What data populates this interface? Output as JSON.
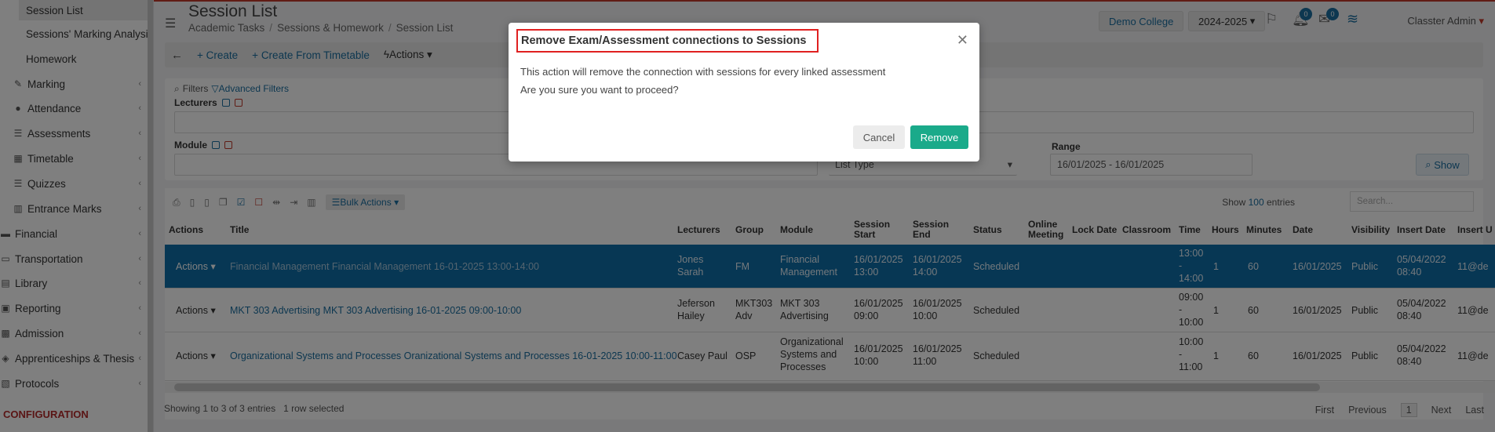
{
  "sidebar": {
    "items": [
      {
        "label": "Session List"
      },
      {
        "label": "Sessions' Marking Analysis"
      },
      {
        "label": "Homework"
      },
      {
        "label": "Marking",
        "icon": "edit-icon"
      },
      {
        "label": "Attendance",
        "icon": "user-icon"
      },
      {
        "label": "Assessments",
        "icon": "list-icon"
      },
      {
        "label": "Timetable",
        "icon": "calendar-icon"
      },
      {
        "label": "Quizzes",
        "icon": "list-icon"
      },
      {
        "label": "Entrance Marks",
        "icon": "building-icon"
      },
      {
        "label": "Financial",
        "icon": "money-icon"
      },
      {
        "label": "Transportation",
        "icon": "bus-icon"
      },
      {
        "label": "Library",
        "icon": "book-icon"
      },
      {
        "label": "Reporting",
        "icon": "printer-icon"
      },
      {
        "label": "Admission",
        "icon": "admission-icon"
      },
      {
        "label": "Apprenticeships & Thesis",
        "icon": "cube-icon"
      },
      {
        "label": "Protocols",
        "icon": "protocol-icon"
      }
    ],
    "config_label": "CONFIGURATION"
  },
  "header": {
    "title": "Session List",
    "breadcrumb": [
      "Academic Tasks",
      "Sessions & Homework",
      "Session List"
    ],
    "college": "Demo College",
    "year": "2024-2025",
    "notif_count": "0",
    "mail_count": "0",
    "user": "Classter Admin"
  },
  "toolbar": {
    "create": "Create",
    "create_tt": "Create From Timetable",
    "actions": "Actions"
  },
  "filters": {
    "filters_label": "Filters",
    "advanced": "Advanced Filters",
    "lecturers": "Lecturers",
    "module": "Module",
    "list_type": "List Type",
    "range_label": "Range",
    "range_value": "16/01/2025 - 16/01/2025",
    "show": "Show"
  },
  "table": {
    "bulk_actions": "Bulk Actions",
    "show_label": "Show",
    "show_count": "100",
    "entries": "entries",
    "search_placeholder": "Search...",
    "headers": {
      "actions": "Actions",
      "title": "Title",
      "lecturers": "Lecturers",
      "group": "Group",
      "module": "Module",
      "session_start": "Session Start",
      "session_end": "Session End",
      "status": "Status",
      "online": "Online Meeting",
      "lock_date": "Lock Date",
      "classroom": "Classroom",
      "time": "Time",
      "hours": "Hours",
      "minutes": "Minutes",
      "date": "Date",
      "visibility": "Visibility",
      "insert_date": "Insert Date",
      "insert_u": "Insert U"
    },
    "rows": [
      {
        "actions": "Actions",
        "title": "Financial Management Financial Management 16-01-2025 13:00-14:00",
        "lecturer1": "Jones",
        "lecturer2": "Sarah",
        "group": "FM",
        "module1": "Financial",
        "module2": "Management",
        "module3": "",
        "start1": "16/01/2025",
        "start2": "13:00",
        "end1": "16/01/2025",
        "end2": "14:00",
        "status": "Scheduled",
        "time1": "13:00",
        "time2": "-",
        "time3": "14:00",
        "hours": "1",
        "minutes": "60",
        "date": "16/01/2025",
        "visibility": "Public",
        "ins1": "05/04/2022",
        "ins2": "08:40",
        "insu": "11@de"
      },
      {
        "actions": "Actions",
        "title": "MKT 303 Advertising MKT 303 Advertising 16-01-2025 09:00-10:00",
        "lecturer1": "Jeferson",
        "lecturer2": "Hailey",
        "group": "MKT303 Adv",
        "module1": "MKT 303",
        "module2": "Advertising",
        "module3": "",
        "start1": "16/01/2025",
        "start2": "09:00",
        "end1": "16/01/2025",
        "end2": "10:00",
        "status": "Scheduled",
        "time1": "09:00",
        "time2": "-",
        "time3": "10:00",
        "hours": "1",
        "minutes": "60",
        "date": "16/01/2025",
        "visibility": "Public",
        "ins1": "05/04/2022",
        "ins2": "08:40",
        "insu": "11@de"
      },
      {
        "actions": "Actions",
        "title": "Organizational Systems and Processes Oranizational Systems and Processes 16-01-2025 10:00-11:00",
        "lecturer1": "Casey Paul",
        "lecturer2": "",
        "group": "OSP",
        "module1": "Organizational",
        "module2": "Systems and",
        "module3": "Processes",
        "start1": "16/01/2025",
        "start2": "10:00",
        "end1": "16/01/2025",
        "end2": "11:00",
        "status": "Scheduled",
        "time1": "10:00",
        "time2": "-",
        "time3": "11:00",
        "hours": "1",
        "minutes": "60",
        "date": "16/01/2025",
        "visibility": "Public",
        "ins1": "05/04/2022",
        "ins2": "08:40",
        "insu": "11@de"
      }
    ],
    "info": "Showing 1 to 3 of 3 entries",
    "selected": "1 row selected",
    "pager": {
      "first": "First",
      "previous": "Previous",
      "current": "1",
      "next": "Next",
      "last": "Last"
    }
  },
  "modal": {
    "title": "Remove Exam/Assessment connections to Sessions",
    "line1": "This action will remove the connection with sessions for every linked assessment",
    "line2": "Are you sure you want to proceed?",
    "cancel": "Cancel",
    "remove": "Remove"
  },
  "colors": {
    "primary": "#1a6ea0",
    "selected_row": "#0e6ea8",
    "remove_button": "#1aaa8a",
    "highlight": "#e02020"
  }
}
